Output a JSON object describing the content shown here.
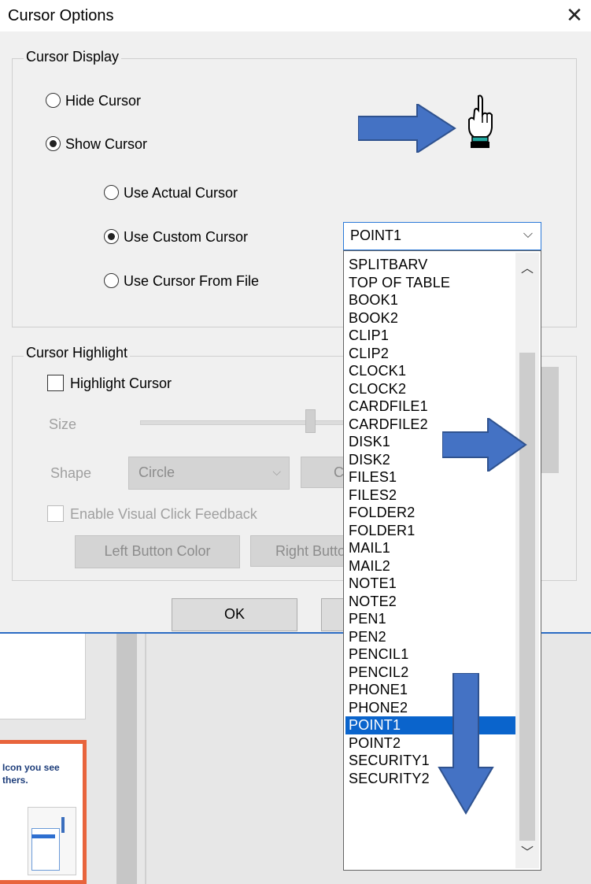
{
  "dialog": {
    "title": "Cursor Options",
    "close_icon": "close-icon"
  },
  "cursor_display": {
    "legend": "Cursor Display",
    "hide_label": "Hide Cursor",
    "show_label": "Show Cursor",
    "actual_label": "Use Actual Cursor",
    "custom_label": "Use Custom Cursor",
    "file_label": "Use Cursor From File",
    "selected_mode": "Show Cursor",
    "selected_source": "Use Custom Cursor"
  },
  "combo": {
    "value": "POINT1",
    "arrow_icon": "chevron-down-icon"
  },
  "dropdown": {
    "items": [
      "SPLITBARV",
      "TOP OF TABLE",
      "BOOK1",
      "BOOK2",
      "CLIP1",
      "CLIP2",
      "CLOCK1",
      "CLOCK2",
      "CARDFILE1",
      "CARDFILE2",
      "DISK1",
      "DISK2",
      "FILES1",
      "FILES2",
      "FOLDER2",
      "FOLDER1",
      "MAIL1",
      "MAIL2",
      "NOTE1",
      "NOTE2",
      "PEN1",
      "PEN2",
      "PENCIL1",
      "PENCIL2",
      "PHONE1",
      "PHONE2",
      "POINT1",
      "POINT2",
      "SECURITY1",
      "SECURITY2"
    ],
    "selected": "POINT1"
  },
  "cursor_highlight": {
    "legend": "Cursor Highlight",
    "highlight_label": "Highlight Cursor",
    "size_label": "Size",
    "shape_label": "Shape",
    "shape_value": "Circle",
    "color_btn_partial": "C",
    "feedback_label": "Enable Visual Click Feedback",
    "left_btn": "Left Button Color",
    "right_btn_partial": "Right Butto"
  },
  "footer": {
    "ok_label": "OK"
  },
  "background": {
    "thumb_text_line1": "Icon you see",
    "thumb_text_line2": "thers."
  },
  "colors": {
    "accent": "#0a64cc",
    "arrow": "#4472c4",
    "slide_border": "#e8643c"
  }
}
